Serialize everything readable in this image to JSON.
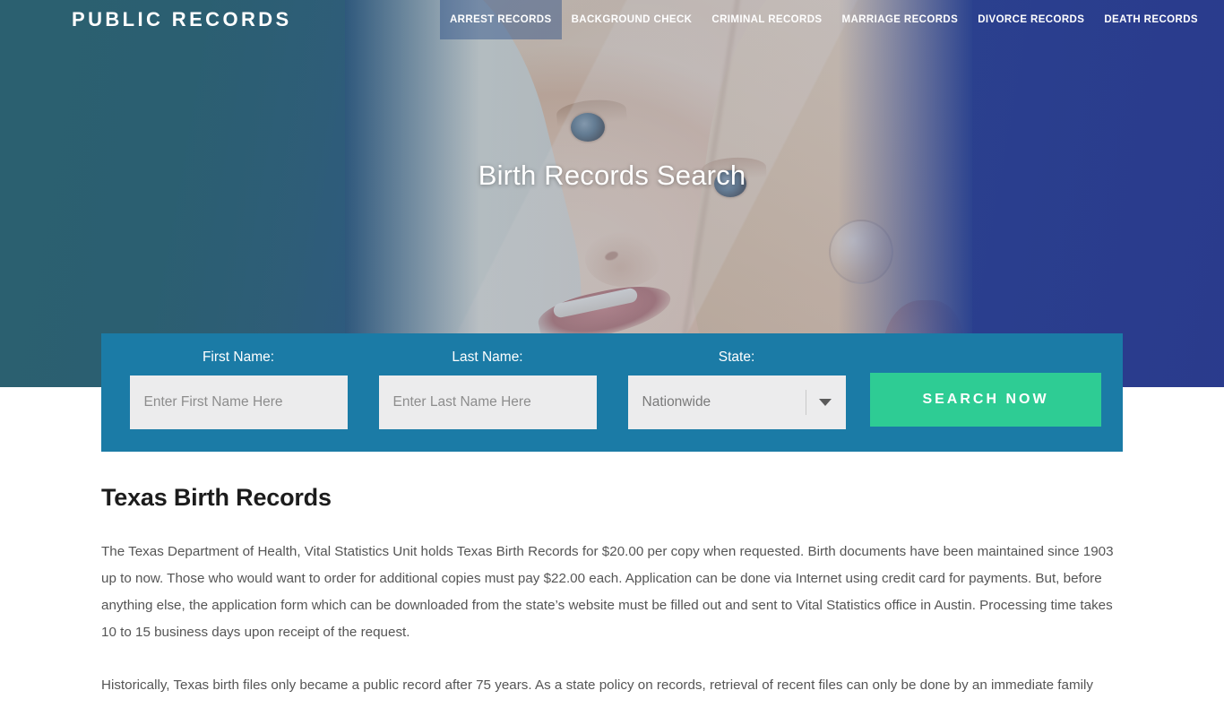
{
  "brand": "PUBLIC RECORDS",
  "nav": {
    "items": [
      {
        "label": "ARREST RECORDS",
        "active": true
      },
      {
        "label": "BACKGROUND CHECK",
        "active": false
      },
      {
        "label": "CRIMINAL RECORDS",
        "active": false
      },
      {
        "label": "MARRIAGE RECORDS",
        "active": false
      },
      {
        "label": "DIVORCE RECORDS",
        "active": false
      },
      {
        "label": "DEATH RECORDS",
        "active": false
      }
    ]
  },
  "hero": {
    "title": "Birth Records Search",
    "image_alt": "baby-photo"
  },
  "search": {
    "first_name": {
      "label": "First Name:",
      "placeholder": "Enter First Name Here",
      "value": ""
    },
    "last_name": {
      "label": "Last Name:",
      "placeholder": "Enter Last Name Here",
      "value": ""
    },
    "state": {
      "label": "State:",
      "selected": "Nationwide",
      "options": [
        "Nationwide"
      ]
    },
    "submit_label": "SEARCH NOW"
  },
  "content": {
    "heading": "Texas Birth Records",
    "paragraphs": [
      "The Texas Department of Health, Vital Statistics Unit holds Texas Birth Records for $20.00 per copy when requested. Birth documents have been maintained since 1903 up to now. Those who would want to order for additional copies must pay $22.00 each. Application can be done via Internet using credit card for payments. But, before anything else, the application form which can be downloaded from the state’s website must be filled out and sent to Vital Statistics office in Austin. Processing time takes 10 to 15 business days upon receipt of the request.",
      "Historically, Texas birth files only became a public record after 75 years. As a state policy on records, retrieval of recent files can only be done by an immediate family"
    ]
  },
  "colors": {
    "hero_left": "#2b6070",
    "hero_right": "#2a3a8c",
    "panel": "#1b7ba6",
    "accent_green": "#2ecc94",
    "input_bg": "#ececed",
    "heading": "#1c1c1c",
    "body_text": "#555555"
  }
}
